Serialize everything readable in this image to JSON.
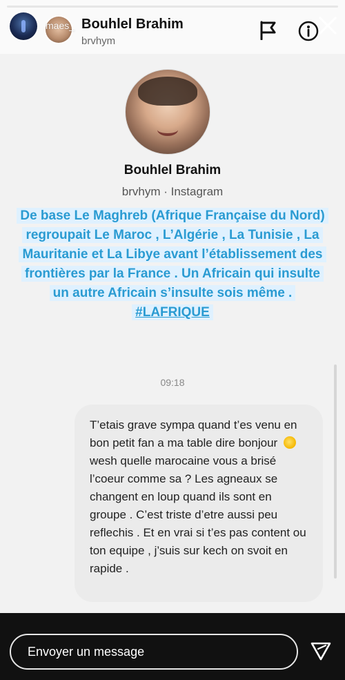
{
  "header": {
    "overlay_username": "maes_",
    "name": "Bouhlel Brahim",
    "handle": "brvhym",
    "icons": {
      "report": "flag-icon",
      "info": "info-icon",
      "close": "close-icon"
    }
  },
  "profile": {
    "name": "Bouhlel Brahim",
    "meta": "brvhym · Instagram"
  },
  "caption": {
    "text": "De base Le Maghreb (Afrique Française du Nord) regroupait Le Maroc , L’Algérie , La Tunisie , La Mauritanie et La Libye avant l’établissement des frontières par la France . Un Africain qui insulte un autre Africain s’insulte sois même .",
    "hashtag": "#LAFRIQUE",
    "color": "#2a9bd2",
    "highlight": "#dff1ff"
  },
  "chat": {
    "timestamp": "09:18",
    "message_part1": "T’etais grave sympa quand t’es venu en bon petit fan a ma table dire bonjour",
    "message_emoji": "thinking-face-icon",
    "message_part2": "wesh quelle marocaine vous a brisé l’coeur comme sa ? Les agneaux se changent en loup quand ils sont en groupe . C’est triste d’etre aussi peu reflechis . Et en vrai si t’es pas content ou ton equipe , j’suis sur kech on svoit en rapide ."
  },
  "composer": {
    "placeholder": "Envoyer un message",
    "send_icon": "send-icon"
  }
}
